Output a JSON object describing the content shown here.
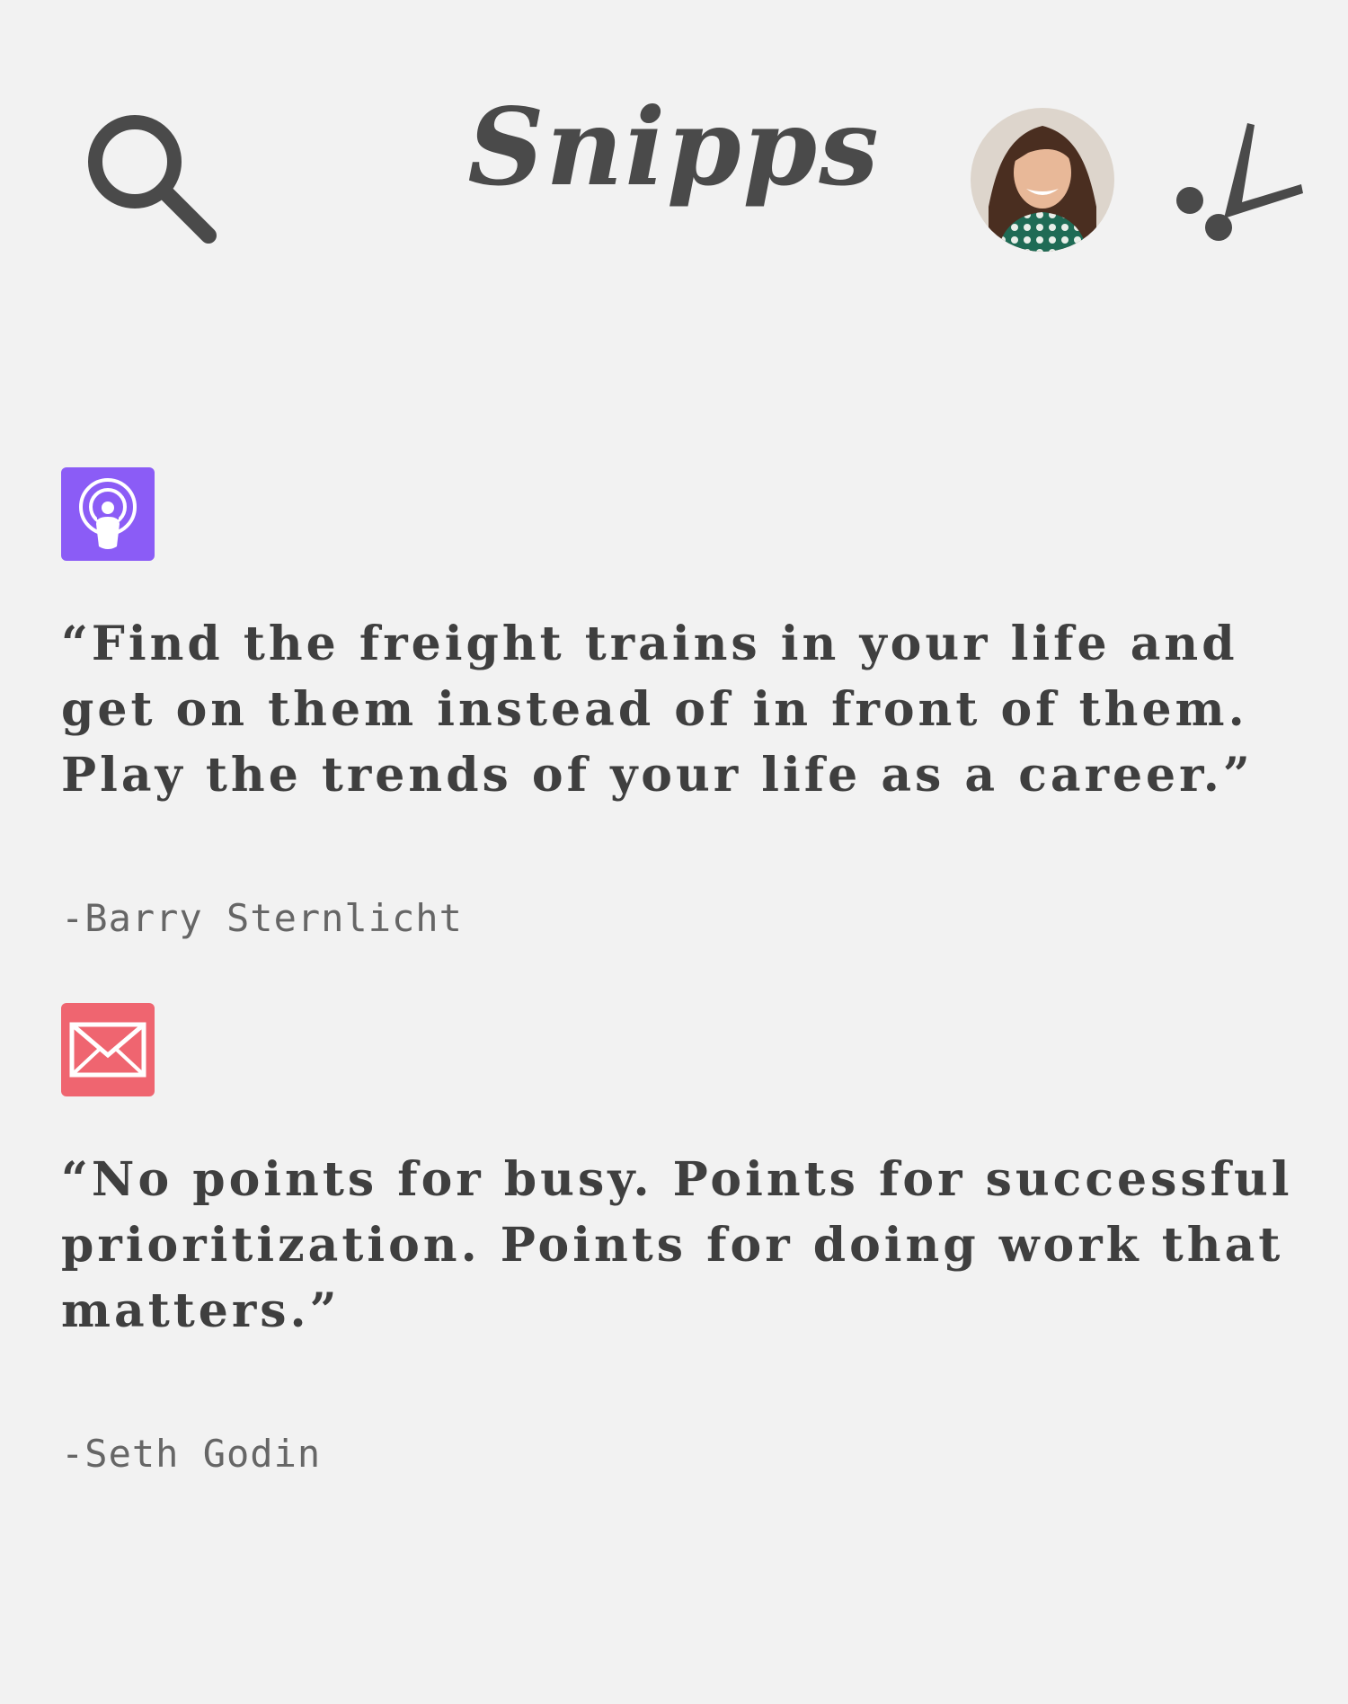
{
  "header": {
    "title": "Snipps",
    "search_icon": "search-icon",
    "avatar_icon": "user-avatar",
    "snip_icon": "scissors-icon"
  },
  "snippets": [
    {
      "source_icon": "podcast-icon",
      "source_color": "#8b5cf6",
      "quote": "“Find the freight trains in your life and get on them instead of in front of them. Play the trends of your life as a career.”",
      "author": "-Barry Sternlicht"
    },
    {
      "source_icon": "mail-icon",
      "source_color": "#ef6570",
      "quote": "“No points for busy. Points for successful prioritization. Points for doing work that matters.”",
      "author": "-Seth Godin"
    }
  ]
}
